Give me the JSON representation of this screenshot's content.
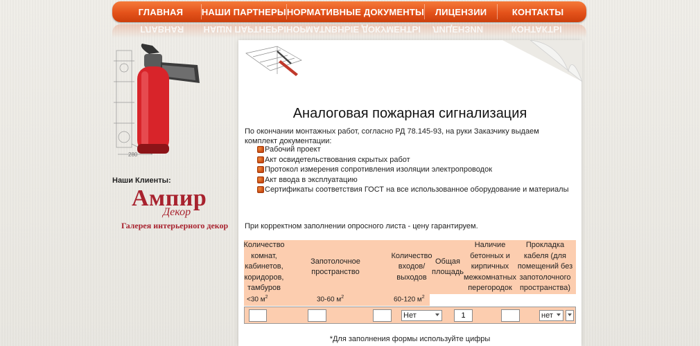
{
  "nav": {
    "items": [
      "ГЛАВНАЯ",
      "НАШИ ПАРТНЕРЫ",
      "НОРМАТИВНЫЕ ДОКУМЕНТЫ",
      "ЛИЦЕНЗИИ",
      "КОНТАКТЫ"
    ]
  },
  "sidebar": {
    "drawing_label": "280",
    "clients_label": "Наши Клиенты:",
    "logo": {
      "main": "Ампир",
      "sub": "Декор",
      "tagline": "Галерея интерьерного декор"
    }
  },
  "main": {
    "title": "Аналоговая пожарная сигнализация",
    "intro": "По окончании монтажных работ, согласно РД 78.145-93, на руки Заказчику выдаем комплект документации:",
    "documents": [
      "Рабочий проект",
      "Акт освидетельствования скрытых работ",
      "Протокол измерения сопротивления изоляции электропроводок",
      "Акт ввода в эксплуатацию",
      "Сертификаты соответствия ГОСТ на все использованное оборудование и материалы"
    ],
    "guarantee": "При корректном заполнении опросного листа - цену гарантируем.",
    "footnote": "*Для заполнения формы используйте цифры"
  },
  "form": {
    "headers": [
      "Количество комнат, кабинетов, коридоров, тамбуров",
      "Запотолочное пространство",
      "Количество входов/ выходов",
      "Общая площадь",
      "Наличие бетонных и кирпичных межкомнатных перегородок",
      "Прокладка кабеля (для помещений без запотолочного пространства)"
    ],
    "area_ranges": [
      {
        "range": "<30 м",
        "sup": "2"
      },
      {
        "range": "30-60 м",
        "sup": "2"
      },
      {
        "range": "60-120 м",
        "sup": "2"
      }
    ],
    "ceiling_select": "Нет",
    "partitions_value": "1",
    "cable_select": "нет"
  }
}
